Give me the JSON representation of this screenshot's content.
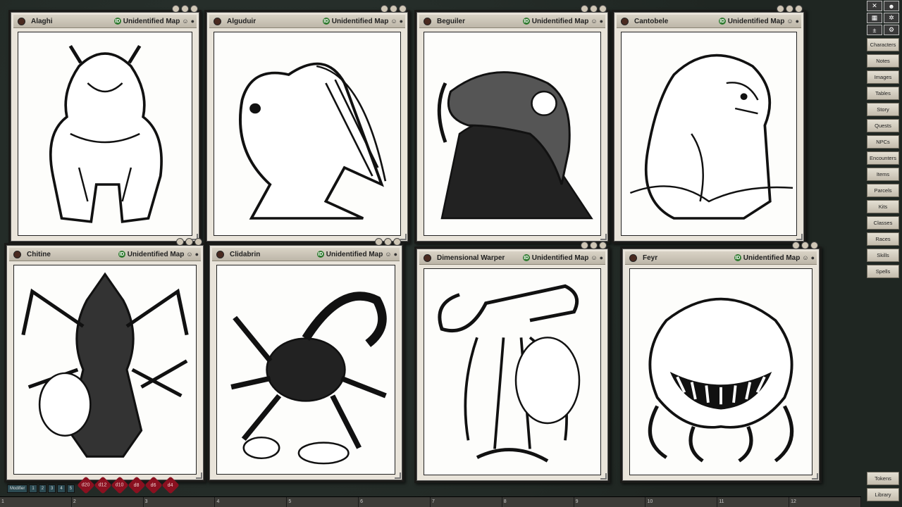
{
  "map_label": "Unidentified Map",
  "windows": [
    {
      "name": "Alaghi"
    },
    {
      "name": "Alguduir"
    },
    {
      "name": "Beguiler"
    },
    {
      "name": "Cantobele"
    },
    {
      "name": "Chitine"
    },
    {
      "name": "Clidabrin"
    },
    {
      "name": "Dimensional Warper"
    },
    {
      "name": "Feyr"
    }
  ],
  "sidebar": {
    "top_icons": [
      "close-icon",
      "party-icon",
      "grid-icon",
      "lighting-icon",
      "modifier-icon",
      "options-icon"
    ],
    "items": [
      "Characters",
      "Notes",
      "Images",
      "Tables",
      "Story",
      "Quests",
      "NPCs",
      "Encounters",
      "Items",
      "Parcels",
      "Kits",
      "Classes",
      "Races",
      "Skills",
      "Spells"
    ],
    "bottom": [
      "Tokens",
      "Library"
    ]
  },
  "modifier": {
    "label": "Modifier",
    "slots": [
      "1",
      "2",
      "3",
      "4",
      "5"
    ]
  },
  "dice": [
    "d20",
    "d12",
    "d10",
    "d8",
    "d6",
    "d4"
  ],
  "hotbar": [
    "1",
    "2",
    "3",
    "4",
    "5",
    "6",
    "7",
    "8",
    "9",
    "10",
    "11",
    "12"
  ]
}
